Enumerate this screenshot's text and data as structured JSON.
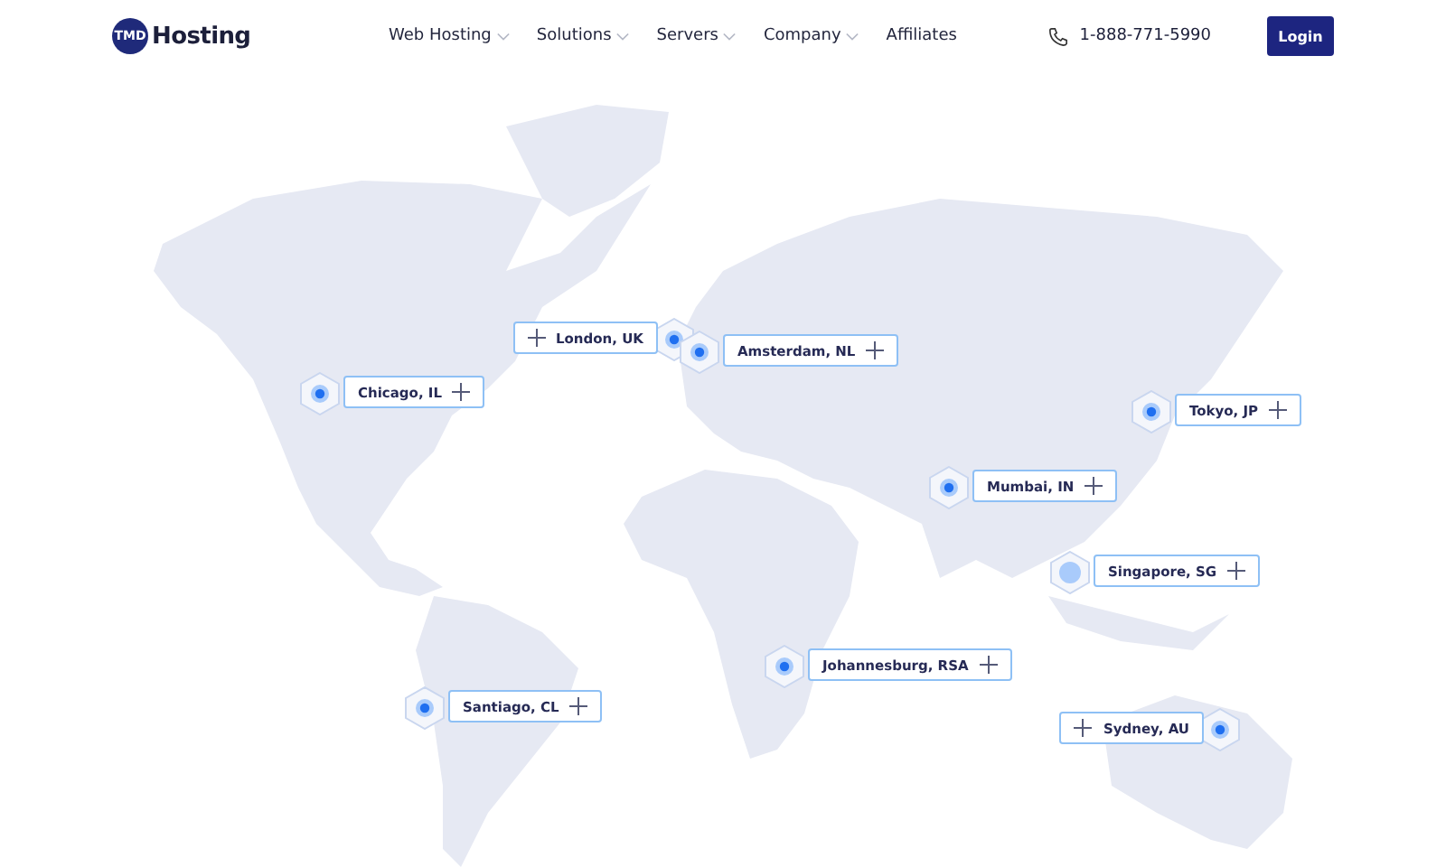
{
  "header": {
    "logo": {
      "badge": "TMD",
      "name": "Hosting"
    },
    "nav": [
      {
        "label": "Web Hosting",
        "dropdown": true
      },
      {
        "label": "Solutions",
        "dropdown": true
      },
      {
        "label": "Servers",
        "dropdown": true
      },
      {
        "label": "Company",
        "dropdown": true
      },
      {
        "label": "Affiliates",
        "dropdown": false
      }
    ],
    "phone": "1-888-771-5990",
    "login": "Login"
  },
  "locations": [
    {
      "label": "Chicago, IL",
      "kind": "dot"
    },
    {
      "label": "London, UK",
      "kind": "dot"
    },
    {
      "label": "Amsterdam, NL",
      "kind": "dot"
    },
    {
      "label": "Tokyo, JP",
      "kind": "dot"
    },
    {
      "label": "Mumbai, IN",
      "kind": "dot"
    },
    {
      "label": "Singapore, SG",
      "kind": "faded"
    },
    {
      "label": "Johannesburg, RSA",
      "kind": "dot"
    },
    {
      "label": "Santiago, CL",
      "kind": "dot"
    },
    {
      "label": "Sydney, AU",
      "kind": "dot"
    }
  ]
}
